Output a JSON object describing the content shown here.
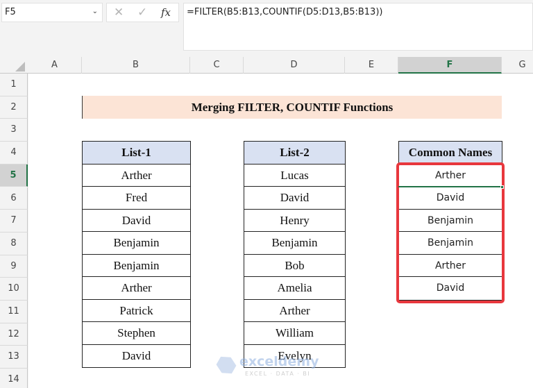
{
  "formula_bar": {
    "name_box": "F5",
    "cancel_icon": "✕",
    "enter_icon": "✓",
    "fx_label": "fx",
    "formula": "=FILTER(B5:B13,COUNTIF(D5:D13,B5:B13))"
  },
  "columns": [
    "A",
    "B",
    "C",
    "D",
    "E",
    "F",
    "G"
  ],
  "active_column": "F",
  "rows": [
    "1",
    "2",
    "3",
    "4",
    "5",
    "6",
    "7",
    "8",
    "9",
    "10",
    "11",
    "12",
    "13",
    "14"
  ],
  "active_row": "5",
  "sheet": {
    "title": "Merging FILTER, COUNTIF Functions",
    "list1": {
      "header": "List-1",
      "items": [
        "Arther",
        "Fred",
        "David",
        "Benjamin",
        "Benjamin",
        "Arther",
        "Patrick",
        "Stephen",
        "David"
      ]
    },
    "list2": {
      "header": "List-2",
      "items": [
        "Lucas",
        "David",
        "Henry",
        "Benjamin",
        "Bob",
        "Amelia",
        "Arther",
        "William",
        "Evelyn"
      ]
    },
    "common": {
      "header": "Common Names",
      "items": [
        "Arther",
        "David",
        "Benjamin",
        "Benjamin",
        "Arther",
        "David"
      ]
    }
  },
  "watermark": {
    "name": "exceldemy",
    "tagline": "EXCEL · DATA · BI"
  }
}
